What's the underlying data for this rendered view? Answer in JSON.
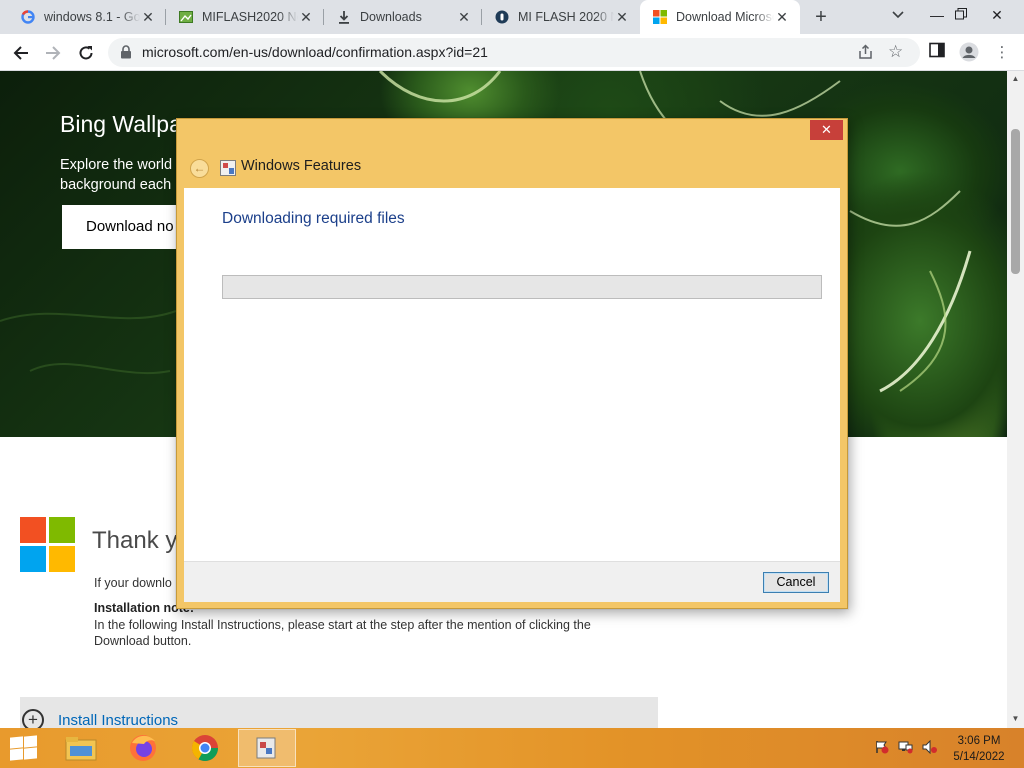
{
  "browser": {
    "tabs": [
      {
        "title": "windows 8.1 - Goo",
        "icon": "google-icon"
      },
      {
        "title": "MIFLASH2020 New",
        "icon": "image-icon"
      },
      {
        "title": "Downloads",
        "icon": "download-icon"
      },
      {
        "title": "MI FLASH 2020 Ne",
        "icon": "site-icon"
      },
      {
        "title": "Download Microso",
        "icon": "microsoft-icon",
        "active": true
      }
    ],
    "url": "microsoft.com/en-us/download/confirmation.aspx?id=21"
  },
  "page": {
    "hero_title": "Bing Wallpa",
    "hero_text": "Explore the world\nbackground each",
    "hero_button": "Download no",
    "thanks": "Thank yo",
    "if_text": "If your downlo",
    "note_title": "Installation note:",
    "note_text": "In the following Install Instructions, please start at the step after the mention of clicking the Download button.",
    "install_label": "Install Instructions",
    "install_icon_glyph": "+"
  },
  "dialog": {
    "title": "Windows Features",
    "heading": "Downloading required files",
    "progress_percent": 0,
    "cancel_label": "Cancel",
    "close_glyph": "✕",
    "colors": {
      "frame": "#f3c667",
      "close": "#c7403a",
      "heading": "#1b3f8a"
    }
  },
  "taskbar": {
    "apps": [
      "file-explorer-icon",
      "firefox-icon",
      "chrome-icon",
      "windows-features-icon"
    ],
    "time": "3:06 PM",
    "date": "5/14/2022",
    "color": "#e89a2d"
  }
}
